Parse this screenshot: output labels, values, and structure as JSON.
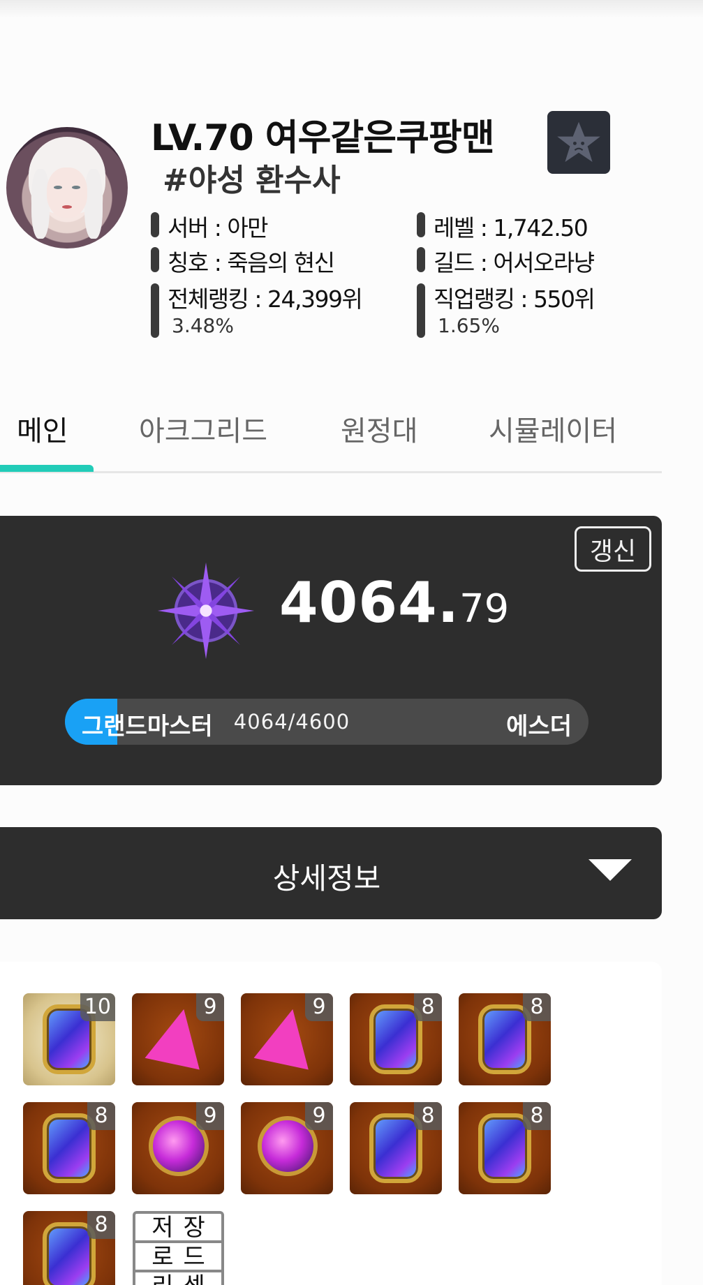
{
  "profile": {
    "level": "LV.70",
    "name": "여우같은쿠팡맨",
    "class_tag": "#야성 환수사",
    "avatar_icon": "character-portrait",
    "favorite_icon": "star-icon",
    "stats": {
      "server": "서버 : 아만",
      "level_detail": "레벨 : 1,742.50",
      "title": "칭호 : 죽음의 현신",
      "guild": "길드 : 어서오라냥",
      "overall_rank": "전체랭킹 : 24,399위",
      "overall_pct": "3.48%",
      "class_rank": "직업랭킹 : 550위",
      "class_pct": "1.65%"
    }
  },
  "tabs": [
    {
      "label": "메인",
      "active": true
    },
    {
      "label": "아크그리드",
      "active": false
    },
    {
      "label": "원정대",
      "active": false
    },
    {
      "label": "시뮬레이터",
      "active": false
    }
  ],
  "score_card": {
    "refresh_label": "갱신",
    "emblem_icon": "purple-star-emblem",
    "score_int": "4064.",
    "score_dec": "79",
    "tier_current": "그랜드마스터",
    "tier_next": "에스더",
    "progress_text": "4064/4600",
    "progress_fraction": 0.1,
    "accent_color": "#19a1f5"
  },
  "detail": {
    "label": "상세정보",
    "toggle_icon": "triangle-down-icon"
  },
  "gems": [
    {
      "kind": "rect",
      "bg": "gold",
      "level": "10"
    },
    {
      "kind": "tri",
      "bg": "brown",
      "level": "9"
    },
    {
      "kind": "tri",
      "bg": "brown",
      "level": "9"
    },
    {
      "kind": "rect",
      "bg": "brown",
      "level": "8"
    },
    {
      "kind": "rect",
      "bg": "brown",
      "level": "8"
    },
    {
      "kind": "rect",
      "bg": "brown",
      "level": "8"
    },
    {
      "kind": "round",
      "bg": "brown",
      "level": "9"
    },
    {
      "kind": "round",
      "bg": "brown",
      "level": "9"
    },
    {
      "kind": "rect",
      "bg": "brown",
      "level": "8"
    },
    {
      "kind": "rect",
      "bg": "brown",
      "level": "8"
    },
    {
      "kind": "rect",
      "bg": "brown",
      "level": "8"
    }
  ],
  "save_box": {
    "row1": "저장",
    "row2": "로드",
    "row3": "리셋"
  }
}
